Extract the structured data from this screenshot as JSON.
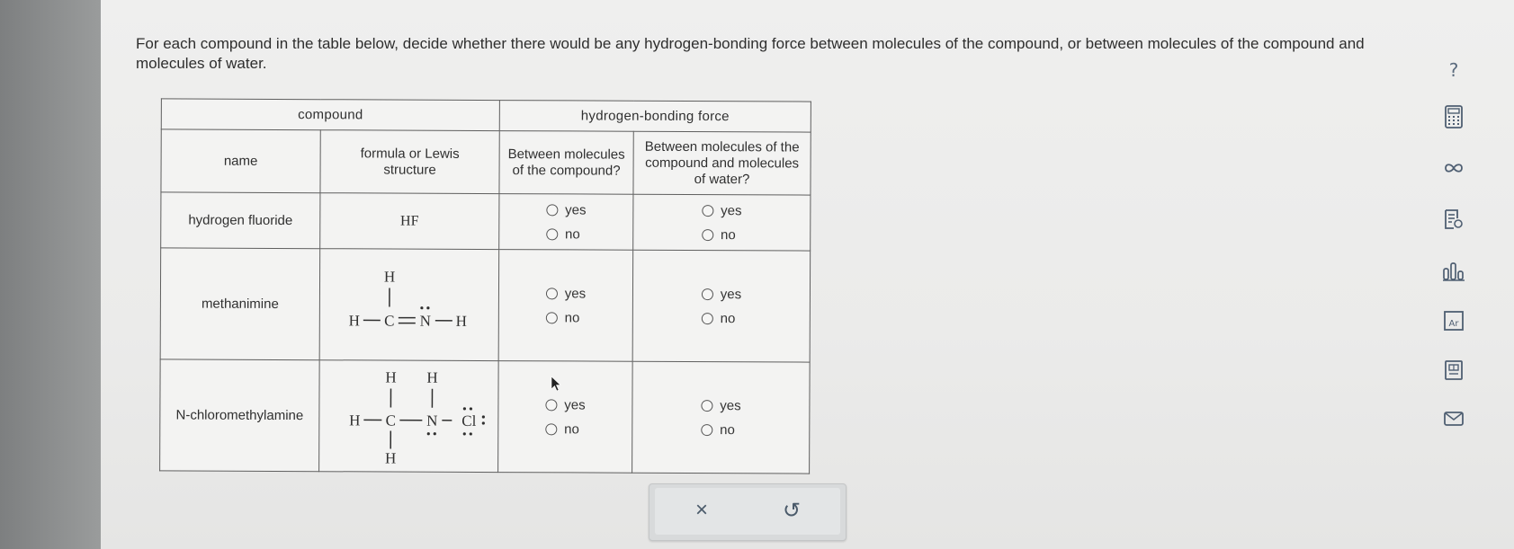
{
  "question": "For each compound in the table below, decide whether there would be any hydrogen-bonding force between molecules of the compound, or between molecules of the compound and molecules of water.",
  "table": {
    "group_headers": {
      "compound": "compound",
      "hbond": "hydrogen-bonding force"
    },
    "column_headers": {
      "name": "name",
      "formula": "formula or Lewis structure",
      "between_compound": "Between molecules of the compound?",
      "between_water": "Between molecules of the compound and molecules of water?"
    },
    "rows": [
      {
        "name": "hydrogen fluoride",
        "formula": "HF",
        "q1": {
          "yes": "yes",
          "no": "no",
          "selected": null
        },
        "q2": {
          "yes": "yes",
          "no": "no",
          "selected": null
        }
      },
      {
        "name": "methanimine",
        "lewis": {
          "top": "H",
          "left": "H",
          "c": "C",
          "n": "N",
          "right": "H"
        },
        "q1": {
          "yes": "yes",
          "no": "no",
          "selected": null
        },
        "q2": {
          "yes": "yes",
          "no": "no",
          "selected": null
        }
      },
      {
        "name": "N-chloromethylamine",
        "lewis": {
          "h1": "H",
          "h2": "H",
          "left": "H",
          "c": "C",
          "n": "N",
          "cl": "Cl",
          "bottom": "H"
        },
        "q1": {
          "yes": "yes",
          "no": "no",
          "selected": null
        },
        "q2": {
          "yes": "yes",
          "no": "no",
          "selected": null
        }
      }
    ]
  },
  "actions": {
    "clear": "×",
    "undo": "↺"
  },
  "side_tools": {
    "help": "?",
    "icons": [
      "calculator-icon",
      "infinity-icon",
      "notes-icon",
      "chart-icon",
      "periodic-table-icon",
      "reference-icon",
      "mail-icon"
    ]
  },
  "colors": {
    "background": "#ecebeb",
    "border": "#5e5e5e",
    "icon": "#4f5f72"
  }
}
